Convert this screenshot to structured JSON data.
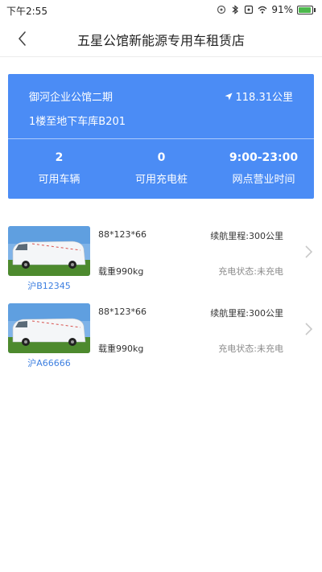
{
  "status_bar": {
    "time": "下午2:55",
    "battery": "91%",
    "battery_level": 0.91
  },
  "header": {
    "title": "五星公馆新能源专用车租赁店"
  },
  "store": {
    "name": "御河企业公馆二期",
    "distance": "118.31公里",
    "address": "1楼至地下车库B201",
    "stats": [
      {
        "value": "2",
        "label": "可用车辆"
      },
      {
        "value": "0",
        "label": "可用充电桩"
      },
      {
        "value": "9:00-23:00",
        "label": "网点营业时间"
      }
    ]
  },
  "vehicles": [
    {
      "plate": "沪B12345",
      "dimensions": "88*123*66",
      "range": "续航里程:300公里",
      "load": "载重990kg",
      "charge_status": "充电状态:未充电"
    },
    {
      "plate": "沪A66666",
      "dimensions": "88*123*66",
      "range": "续航里程:300公里",
      "load": "载重990kg",
      "charge_status": "充电状态:未充电"
    }
  ]
}
